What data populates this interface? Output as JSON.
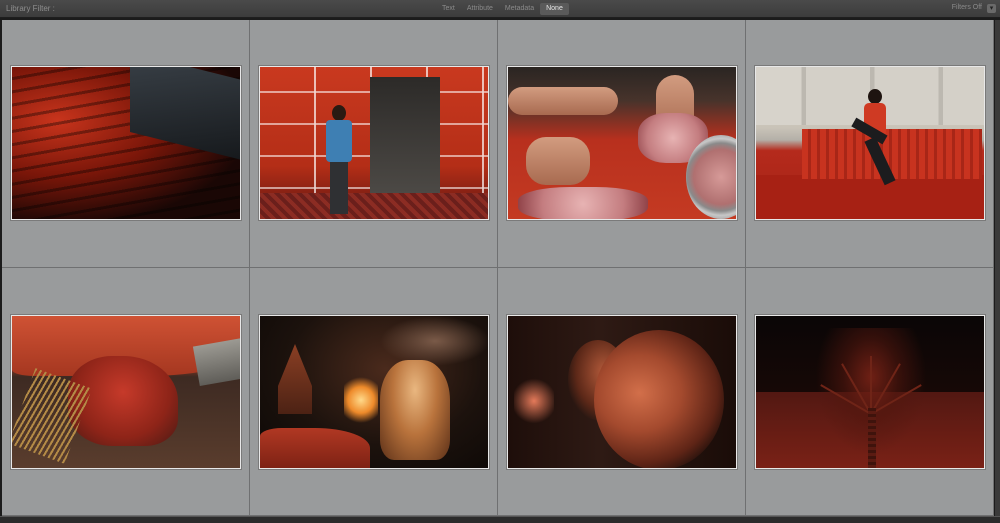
{
  "filter_bar": {
    "title": "Library Filter :",
    "tabs": [
      {
        "label": "Text",
        "active": false
      },
      {
        "label": "Attribute",
        "active": false
      },
      {
        "label": "Metadata",
        "active": false
      },
      {
        "label": "None",
        "active": true
      }
    ],
    "preset_label": "Filters Off",
    "lock_icon": "lock-icon"
  },
  "colors": {
    "cell_background": "#999b9c",
    "cell_border": "#6f7071",
    "thumb_border": "#e8e8e8",
    "toolbar_bg": "#3c3c3c"
  },
  "grid": {
    "columns": 4,
    "rows": 2,
    "photos": [
      {
        "subject": "red-fabric-shadows"
      },
      {
        "subject": "man-walking-past-red-tent"
      },
      {
        "subject": "hands-cutting-meat"
      },
      {
        "subject": "boy-running-red-table"
      },
      {
        "subject": "figure-under-red-tarp"
      },
      {
        "subject": "priest-night-ceremony"
      },
      {
        "subject": "man-face-red-light"
      },
      {
        "subject": "palm-tree-red-night"
      }
    ]
  }
}
